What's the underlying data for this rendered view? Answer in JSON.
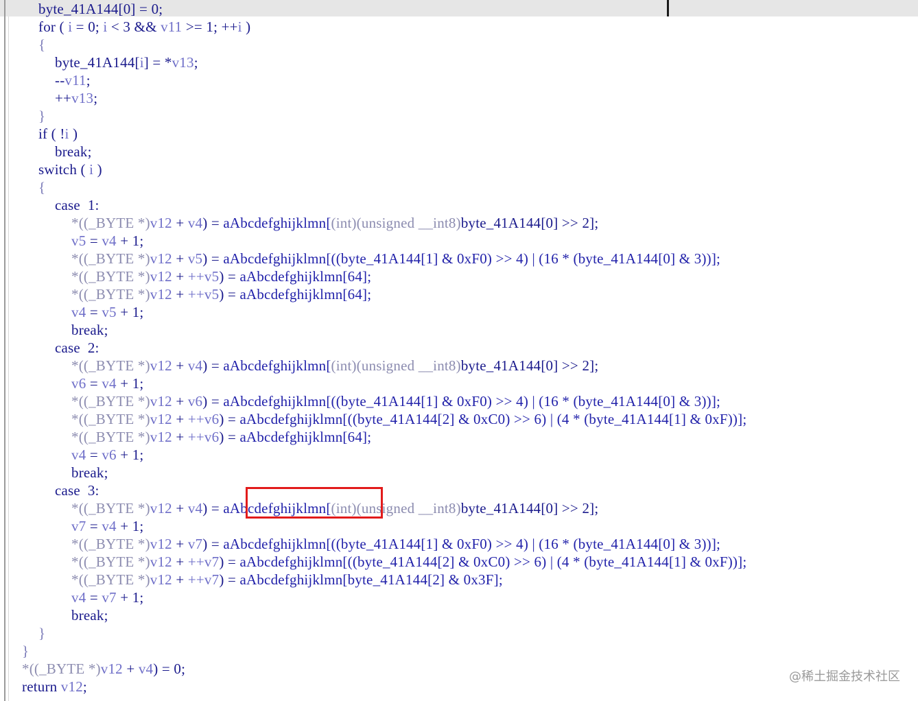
{
  "watermark": "@稀土掘金技术社区",
  "highlight": "aAbcdefghijklmn",
  "code_lines": [
    [
      [
        "byte_41A144[0]",
        "kw"
      ],
      [
        " = ",
        "op"
      ],
      [
        "0;",
        "num"
      ]
    ],
    [
      [
        "for",
        "kw"
      ],
      [
        " ( ",
        "pun"
      ],
      [
        "i",
        "var"
      ],
      [
        " = ",
        "op"
      ],
      [
        "0; ",
        "num"
      ],
      [
        "i",
        "var"
      ],
      [
        " < ",
        "op"
      ],
      [
        "3 ",
        "num"
      ],
      [
        "&& ",
        "op"
      ],
      [
        "v11",
        "var"
      ],
      [
        " >= ",
        "op"
      ],
      [
        "1; ",
        "num"
      ],
      [
        "++",
        "op"
      ],
      [
        "i",
        "var"
      ],
      [
        " )",
        "pun"
      ]
    ],
    [
      [
        "{",
        "br"
      ]
    ],
    [
      [
        "byte_41A144[",
        "kw"
      ],
      [
        "i",
        "var"
      ],
      [
        "] = ",
        "op"
      ],
      [
        "*",
        "op"
      ],
      [
        "v13",
        "var"
      ],
      [
        ";",
        "pun"
      ]
    ],
    [
      [
        "--",
        "op"
      ],
      [
        "v11",
        "var"
      ],
      [
        ";",
        "pun"
      ]
    ],
    [
      [
        "++",
        "op"
      ],
      [
        "v13",
        "var"
      ],
      [
        ";",
        "pun"
      ]
    ],
    [
      [
        "}",
        "br"
      ]
    ],
    [
      [
        "if",
        "kw"
      ],
      [
        " ( ",
        "pun"
      ],
      [
        "!",
        "op"
      ],
      [
        "i",
        "var"
      ],
      [
        " )",
        "pun"
      ]
    ],
    [
      [
        "break;",
        "kw"
      ]
    ],
    [
      [
        "switch",
        "kw"
      ],
      [
        " ( ",
        "pun"
      ],
      [
        "i",
        "var"
      ],
      [
        " )",
        "pun"
      ]
    ],
    [
      [
        "{",
        "br"
      ]
    ],
    [
      [
        "case  1:",
        "kw"
      ]
    ],
    [
      [
        "*((_BYTE *)",
        "cast"
      ],
      [
        "v12",
        "var"
      ],
      [
        " + ",
        "op"
      ],
      [
        "v4",
        "var"
      ],
      [
        ") = ",
        "op"
      ],
      [
        "aAbcdefghijklmn[",
        "str"
      ],
      [
        "(int)(unsigned __int8)",
        "cast"
      ],
      [
        "byte_41A144[0]",
        "kw"
      ],
      [
        " >> ",
        "op"
      ],
      [
        "2];",
        "num"
      ]
    ],
    [
      [
        "v5",
        "var"
      ],
      [
        " = ",
        "op"
      ],
      [
        "v4",
        "var"
      ],
      [
        " + ",
        "op"
      ],
      [
        "1;",
        "num"
      ]
    ],
    [
      [
        "*((_BYTE *)",
        "cast"
      ],
      [
        "v12",
        "var"
      ],
      [
        " + ",
        "op"
      ],
      [
        "v5",
        "var"
      ],
      [
        ") = ",
        "op"
      ],
      [
        "aAbcdefghijklmn[((byte_41A144[1] & 0xF0) >> 4) | (16 * (byte_41A144[0] & 3))];",
        "str"
      ]
    ],
    [
      [
        "*((_BYTE *)",
        "cast"
      ],
      [
        "v12",
        "var"
      ],
      [
        " + ",
        "op"
      ],
      [
        "++v5",
        "var"
      ],
      [
        ") = ",
        "op"
      ],
      [
        "aAbcdefghijklmn[64];",
        "str"
      ]
    ],
    [
      [
        "*((_BYTE *)",
        "cast"
      ],
      [
        "v12",
        "var"
      ],
      [
        " + ",
        "op"
      ],
      [
        "++v5",
        "var"
      ],
      [
        ") = ",
        "op"
      ],
      [
        "aAbcdefghijklmn[64];",
        "str"
      ]
    ],
    [
      [
        "v4",
        "var"
      ],
      [
        " = ",
        "op"
      ],
      [
        "v5",
        "var"
      ],
      [
        " + ",
        "op"
      ],
      [
        "1;",
        "num"
      ]
    ],
    [
      [
        "break;",
        "kw"
      ]
    ],
    [
      [
        "case  2:",
        "kw"
      ]
    ],
    [
      [
        "*((_BYTE *)",
        "cast"
      ],
      [
        "v12",
        "var"
      ],
      [
        " + ",
        "op"
      ],
      [
        "v4",
        "var"
      ],
      [
        ") = ",
        "op"
      ],
      [
        "aAbcdefghijklmn[",
        "str"
      ],
      [
        "(int)(unsigned __int8)",
        "cast"
      ],
      [
        "byte_41A144[0]",
        "kw"
      ],
      [
        " >> ",
        "op"
      ],
      [
        "2];",
        "num"
      ]
    ],
    [
      [
        "v6",
        "var"
      ],
      [
        " = ",
        "op"
      ],
      [
        "v4",
        "var"
      ],
      [
        " + ",
        "op"
      ],
      [
        "1;",
        "num"
      ]
    ],
    [
      [
        "*((_BYTE *)",
        "cast"
      ],
      [
        "v12",
        "var"
      ],
      [
        " + ",
        "op"
      ],
      [
        "v6",
        "var"
      ],
      [
        ") = ",
        "op"
      ],
      [
        "aAbcdefghijklmn[((byte_41A144[1] & 0xF0) >> 4) | (16 * (byte_41A144[0] & 3))];",
        "str"
      ]
    ],
    [
      [
        "*((_BYTE *)",
        "cast"
      ],
      [
        "v12",
        "var"
      ],
      [
        " + ",
        "op"
      ],
      [
        "++v6",
        "var"
      ],
      [
        ") = ",
        "op"
      ],
      [
        "aAbcdefghijklmn[((byte_41A144[2] & 0xC0) >> 6) | (4 * (byte_41A144[1] & 0xF))];",
        "str"
      ]
    ],
    [
      [
        "*((_BYTE *)",
        "cast"
      ],
      [
        "v12",
        "var"
      ],
      [
        " + ",
        "op"
      ],
      [
        "++v6",
        "var"
      ],
      [
        ") = ",
        "op"
      ],
      [
        "aAbcdefghijklmn[64];",
        "str"
      ]
    ],
    [
      [
        "v4",
        "var"
      ],
      [
        " = ",
        "op"
      ],
      [
        "v6",
        "var"
      ],
      [
        " + ",
        "op"
      ],
      [
        "1;",
        "num"
      ]
    ],
    [
      [
        "break;",
        "kw"
      ]
    ],
    [
      [
        "case  3:",
        "kw"
      ]
    ],
    [
      [
        "*((_BYTE *)",
        "cast"
      ],
      [
        "v12",
        "var"
      ],
      [
        " + ",
        "op"
      ],
      [
        "v4",
        "var"
      ],
      [
        ") = ",
        "op"
      ],
      [
        "aAbcdefghijklmn[",
        "str"
      ],
      [
        "(int)(unsigned __int8)",
        "cast"
      ],
      [
        "byte_41A144[0]",
        "kw"
      ],
      [
        " >> ",
        "op"
      ],
      [
        "2];",
        "num"
      ]
    ],
    [
      [
        "v7",
        "var"
      ],
      [
        " = ",
        "op"
      ],
      [
        "v4",
        "var"
      ],
      [
        " + ",
        "op"
      ],
      [
        "1;",
        "num"
      ]
    ],
    [
      [
        "*((_BYTE *)",
        "cast"
      ],
      [
        "v12",
        "var"
      ],
      [
        " + ",
        "op"
      ],
      [
        "v7",
        "var"
      ],
      [
        ") = ",
        "op"
      ],
      [
        "aAbcdefghijklmn[((byte_41A144[1] & 0xF0) >> 4) | (16 * (byte_41A144[0] & 3))];",
        "str"
      ]
    ],
    [
      [
        "*((_BYTE *)",
        "cast"
      ],
      [
        "v12",
        "var"
      ],
      [
        " + ",
        "op"
      ],
      [
        "++v7",
        "var"
      ],
      [
        ") = ",
        "op"
      ],
      [
        "aAbcdefghijklmn[((byte_41A144[2] & 0xC0) >> 6) | (4 * (byte_41A144[1] & 0xF))];",
        "str"
      ]
    ],
    [
      [
        "*((_BYTE *)",
        "cast"
      ],
      [
        "v12",
        "var"
      ],
      [
        " + ",
        "op"
      ],
      [
        "++v7",
        "var"
      ],
      [
        ") = ",
        "op"
      ],
      [
        "aAbcdefghijklmn[byte_41A144[2] & 0x3F];",
        "str"
      ]
    ],
    [
      [
        "v4",
        "var"
      ],
      [
        " = ",
        "op"
      ],
      [
        "v7",
        "var"
      ],
      [
        " + ",
        "op"
      ],
      [
        "1;",
        "num"
      ]
    ],
    [
      [
        "break;",
        "kw"
      ]
    ],
    [
      [
        "}",
        "br"
      ]
    ],
    [
      [
        "}",
        "br"
      ]
    ],
    [
      [
        "*((_BYTE *)",
        "cast"
      ],
      [
        "v12",
        "var"
      ],
      [
        " + ",
        "op"
      ],
      [
        "v4",
        "var"
      ],
      [
        ") = ",
        "op"
      ],
      [
        "0;",
        "num"
      ]
    ],
    [
      [
        "return ",
        "kw"
      ],
      [
        "v12",
        "var"
      ],
      [
        ";",
        "pun"
      ]
    ]
  ]
}
